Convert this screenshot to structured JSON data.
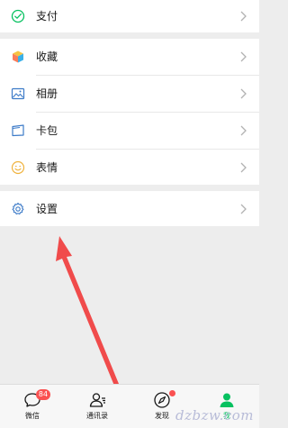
{
  "menu": {
    "pay": {
      "label": "支付",
      "icon": "wechat-pay-icon"
    },
    "favorites": {
      "label": "收藏",
      "icon": "favorites-cube-icon"
    },
    "album": {
      "label": "相册",
      "icon": "album-icon"
    },
    "wallet": {
      "label": "卡包",
      "icon": "card-wallet-icon"
    },
    "stickers": {
      "label": "表情",
      "icon": "sticker-face-icon"
    },
    "settings": {
      "label": "设置",
      "icon": "gear-icon"
    }
  },
  "tabbar": {
    "chats": {
      "label": "微信",
      "badge": "84"
    },
    "contacts": {
      "label": "通讯录"
    },
    "discover": {
      "label": "发现"
    },
    "me": {
      "label": "我"
    }
  },
  "watermark": "dzbzw.com",
  "colors": {
    "accent": "#07c160",
    "badge": "#fa5151",
    "arrow": "#f04b4b",
    "background": "#ededed"
  }
}
